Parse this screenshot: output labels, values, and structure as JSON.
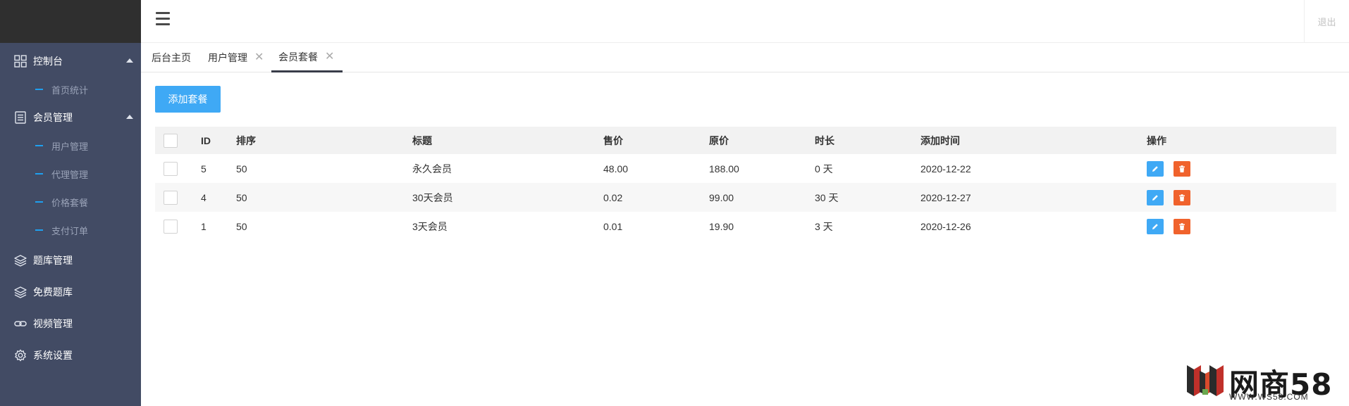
{
  "sidebar": {
    "groups": [
      {
        "label": "控制台",
        "items": [
          "首页统计"
        ]
      },
      {
        "label": "会员管理",
        "items": [
          "用户管理",
          "代理管理",
          "价格套餐",
          "支付订单"
        ]
      }
    ],
    "plain": [
      {
        "label": "题库管理",
        "icon": "layers-icon"
      },
      {
        "label": "免费题库",
        "icon": "layers-icon"
      },
      {
        "label": "视频管理",
        "icon": "link-icon"
      },
      {
        "label": "系统设置",
        "icon": "gear-icon"
      }
    ]
  },
  "topbar": {
    "logout": "退出"
  },
  "tabs": [
    {
      "label": "后台主页"
    },
    {
      "label": "用户管理",
      "close": "✕"
    },
    {
      "label": "会员套餐",
      "close": "✕"
    }
  ],
  "add_button": "添加套餐",
  "table": {
    "headers": [
      "ID",
      "排序",
      "标题",
      "售价",
      "原价",
      "时长",
      "添加时间",
      "操作"
    ],
    "rows": [
      [
        "5",
        "50",
        "永久会员",
        "48.00",
        "188.00",
        "0 天",
        "2020-12-22"
      ],
      [
        "4",
        "50",
        "30天会员",
        "0.02",
        "99.00",
        "30 天",
        "2020-12-27"
      ],
      [
        "1",
        "50",
        "3天会员",
        "0.01",
        "19.90",
        "3 天",
        "2020-12-26"
      ]
    ]
  },
  "watermark": {
    "brand": "网商58",
    "url": "WWW.WS58.COM"
  },
  "colors": {
    "sidebar": "#424b64",
    "accent": "#3fa9f5",
    "danger": "#f0622c"
  }
}
